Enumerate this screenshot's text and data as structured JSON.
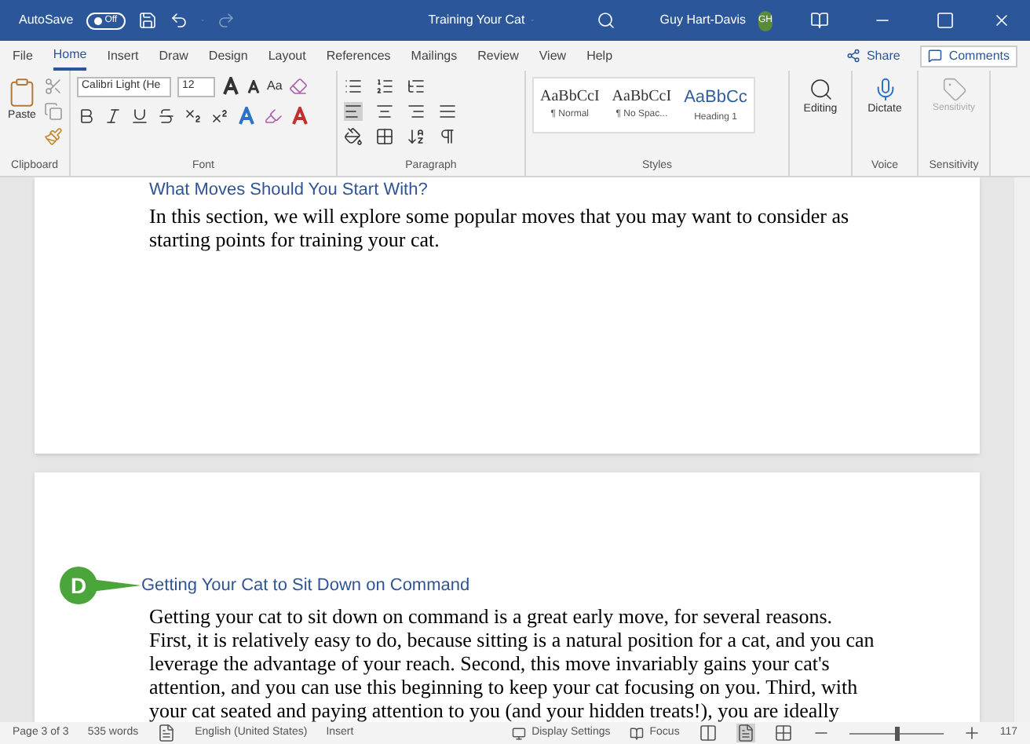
{
  "title_bar": {
    "autosave_label": "AutoSave",
    "autosave": {
      "on": false,
      "label": "Off"
    },
    "document_title": "Training Your Cat",
    "user_name": "Guy Hart-Davis",
    "user_initials": "GH"
  },
  "ribbon_tabs": [
    {
      "label": "File",
      "selected": false
    },
    {
      "label": "Home",
      "selected": true
    },
    {
      "label": "Insert",
      "selected": false
    },
    {
      "label": "Draw",
      "selected": false
    },
    {
      "label": "Design",
      "selected": false
    },
    {
      "label": "Layout",
      "selected": false
    },
    {
      "label": "References",
      "selected": false
    },
    {
      "label": "Mailings",
      "selected": false
    },
    {
      "label": "Review",
      "selected": false
    },
    {
      "label": "View",
      "selected": false
    },
    {
      "label": "Help",
      "selected": false
    }
  ],
  "share_button": "Share",
  "comments_button": "Comments",
  "ribbon": {
    "paste": "Paste",
    "font_name": "Calibri Light (He",
    "font_size": "12",
    "change_case": "Aa",
    "styles": [
      {
        "sample": "AaBbCcI",
        "name": "¶ Normal",
        "kind": "body"
      },
      {
        "sample": "AaBbCcI",
        "name": "¶ No Spac...",
        "kind": "body"
      },
      {
        "sample": "AaBbCc",
        "name": "Heading 1",
        "kind": "heading"
      }
    ],
    "editing": "Editing",
    "dictate": "Dictate",
    "sensitivity": "Sensitivity",
    "groups": [
      "Clipboard",
      "Font",
      "Paragraph",
      "Styles",
      "Voice",
      "Sensitivity"
    ]
  },
  "document": {
    "pages": [
      {
        "heading": "What Moves Should You Start With?",
        "body": "In this section, we will explore some popular moves that you may want to consider as starting points for training your cat."
      },
      {
        "callout": "D",
        "heading": "Getting Your Cat to Sit Down on Command",
        "body": "Getting your cat to sit down on command is a great early move, for several reasons. First, it is relatively easy to do, because sitting is a natural position for a cat, and you can leverage the advantage of your reach. Second, this move invariably gains your cat's attention, and you can use this beginning to keep your cat focusing on you. Third, with your cat seated and paying attention to you (and your hidden treats!), you are ideally"
      }
    ]
  },
  "status_bar": {
    "page": "Page 3 of 3",
    "words": "535 words",
    "language": "English (United States)",
    "mode": "Insert",
    "display_settings": "Display Settings",
    "focus": "Focus",
    "zoom": {
      "level": 0.5
    },
    "zoom_percent": "117"
  }
}
